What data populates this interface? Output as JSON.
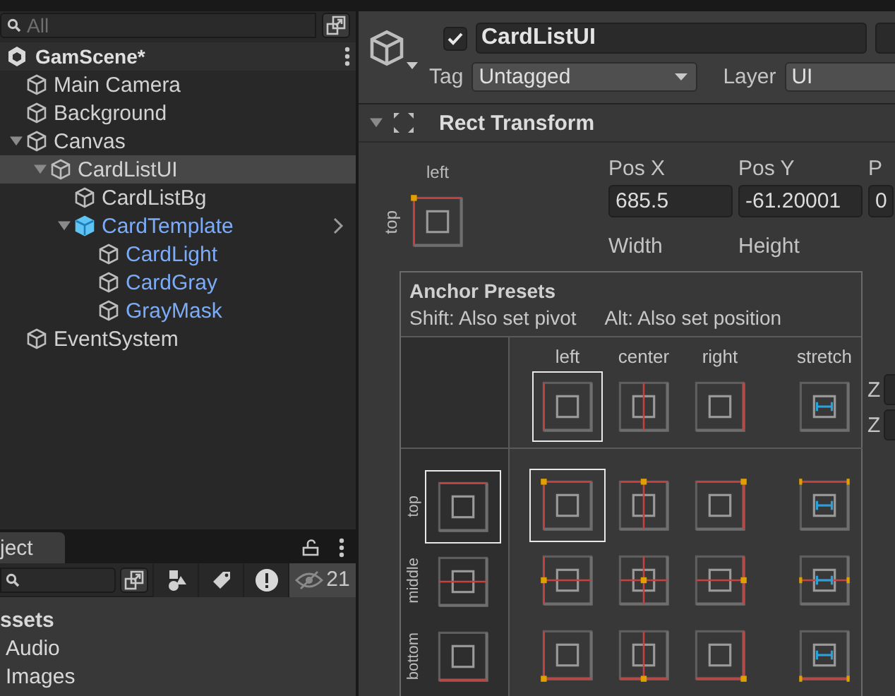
{
  "hierarchy": {
    "search": {
      "placeholder": "All"
    },
    "scene": {
      "title": "GamScene*"
    },
    "items": [
      {
        "label": "Main Camera",
        "kind": "object",
        "selected": false
      },
      {
        "label": "Background",
        "kind": "object",
        "selected": false
      },
      {
        "label": "Canvas",
        "kind": "object",
        "selected": false,
        "expanded": true,
        "children": [
          {
            "label": "CardListUI",
            "kind": "object",
            "selected": true,
            "expanded": true,
            "children": [
              {
                "label": "CardListBg",
                "kind": "object",
                "selected": false
              },
              {
                "label": "CardTemplate",
                "kind": "prefab_root",
                "selected": false,
                "expanded": true,
                "children": [
                  {
                    "label": "CardLight",
                    "kind": "prefab_child",
                    "selected": false
                  },
                  {
                    "label": "CardGray",
                    "kind": "prefab_child",
                    "selected": false
                  },
                  {
                    "label": "GrayMask",
                    "kind": "prefab_child",
                    "selected": false
                  }
                ]
              }
            ]
          }
        ]
      },
      {
        "label": "EventSystem",
        "kind": "object",
        "selected": false
      }
    ]
  },
  "project": {
    "tab": "ject",
    "hidden_count": "21",
    "items": [
      {
        "label": "ssets",
        "kind": "root"
      },
      {
        "label": "Audio",
        "kind": "folder"
      },
      {
        "label": "Images",
        "kind": "folder"
      }
    ]
  },
  "inspector": {
    "active": true,
    "name": "CardListUI",
    "tag": {
      "label": "Tag",
      "value": "Untagged"
    },
    "layer": {
      "label": "Layer",
      "value": "UI"
    },
    "component": {
      "title": "Rect Transform",
      "expanded": true
    },
    "anchor": {
      "label_h": "left",
      "label_v": "top",
      "kind": "top_left"
    },
    "fields": [
      {
        "label": "Pos X",
        "value": "685.5"
      },
      {
        "label": "Pos Y",
        "value": "-61.20001"
      },
      {
        "label": "P",
        "value": "0"
      },
      {
        "label": "Width"
      },
      {
        "label": "Height"
      }
    ],
    "z_labels": [
      "Z",
      "Z"
    ]
  },
  "anchor_presets": {
    "title": "Anchor Presets",
    "hint_left": "Shift: Also set pivot",
    "hint_right": "Alt: Also set position",
    "columns": [
      {
        "label": "left",
        "kind": "left",
        "selected": true
      },
      {
        "label": "center",
        "kind": "center",
        "selected": false
      },
      {
        "label": "right",
        "kind": "right",
        "selected": false
      },
      {
        "label": "stretch",
        "kind": "stretch",
        "selected": false
      }
    ],
    "rows": [
      {
        "label": "top",
        "kind": "top",
        "selected": true
      },
      {
        "label": "middle",
        "kind": "middle",
        "selected": false
      },
      {
        "label": "bottom",
        "kind": "bottom",
        "selected": false
      }
    ]
  }
}
